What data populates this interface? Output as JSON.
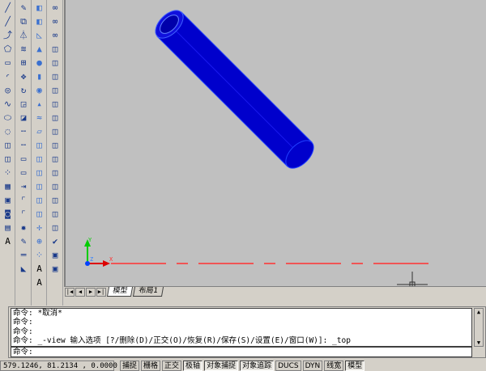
{
  "toolbars": [
    [
      "line-icon",
      "ray-icon",
      "polyline-icon",
      "polygon-icon",
      "rectangle-icon",
      "arc-icon",
      "circle-icon",
      "spline-icon",
      "ellipse-icon",
      "ellipse-arc-icon",
      "insert-block-icon",
      "make-block-icon",
      "point-icon",
      "hatch-icon",
      "gradient-icon",
      "region-icon",
      "table-icon",
      "multiline-text-icon"
    ],
    [
      "erase-icon",
      "copy-icon",
      "mirror-icon",
      "offset-icon",
      "array-icon",
      "move-icon",
      "rotate-icon",
      "scale-icon",
      "stretch-icon",
      "trim-icon",
      "extend-icon",
      "break-at-point-icon",
      "break-icon",
      "join-icon",
      "chamfer-icon",
      "fillet-icon",
      "explode-icon",
      "edit-icon",
      "dimension-icon",
      "dim-style-icon"
    ],
    [
      "box-icon",
      "cube-icon",
      "wedge-icon",
      "cone-icon",
      "sphere-icon",
      "cylinder-icon",
      "torus-icon",
      "pyramid-icon",
      "helix-icon",
      "planar-surface-icon",
      "extrude-icon",
      "presspull-icon",
      "sweep-icon",
      "revolve-icon",
      "loft-icon",
      "slice-icon",
      "ucs-icon",
      "orbit-icon",
      "view-icon",
      "text-icon",
      "text-style-icon"
    ],
    [
      "union-icon",
      "subtract-icon",
      "intersect-icon",
      "extrude-faces-icon",
      "move-faces-icon",
      "offset-faces-icon",
      "delete-faces-icon",
      "rotate-faces-icon",
      "taper-faces-icon",
      "copy-faces-icon",
      "color-faces-icon",
      "copy-edges-icon",
      "color-edges-icon",
      "imprint-icon",
      "clean-icon",
      "separate-icon",
      "shell-icon",
      "check-icon",
      "layers-icon",
      "layer-previous-icon"
    ]
  ],
  "tabs": {
    "model": "模型",
    "layout1": "布局1"
  },
  "ucs": {
    "x": "X",
    "y": "Y",
    "z": "Z"
  },
  "command": {
    "history": [
      "命令: *取消*",
      "命令:",
      "命令:",
      "命令: _-view 输入选项 [?/删除(D)/正交(O)/恢复(R)/保存(S)/设置(E)/窗口(W)]: _top"
    ],
    "prompt": "命令:"
  },
  "status": {
    "coords": "579.1246, 81.2134 , 0.0000",
    "buttons": [
      {
        "label": "捕捉",
        "on": false
      },
      {
        "label": "栅格",
        "on": false
      },
      {
        "label": "正交",
        "on": false
      },
      {
        "label": "极轴",
        "on": true
      },
      {
        "label": "对象捕捉",
        "on": true
      },
      {
        "label": "对象追踪",
        "on": true
      },
      {
        "label": "DUCS",
        "on": false
      },
      {
        "label": "DYN",
        "on": false
      },
      {
        "label": "线宽",
        "on": false
      },
      {
        "label": "模型",
        "on": true
      }
    ]
  },
  "colors": {
    "cylinder": "#0000cc",
    "viewport": "#c0c0c0",
    "xaxis": "#ff3030",
    "yaxis": "#00cc00"
  }
}
